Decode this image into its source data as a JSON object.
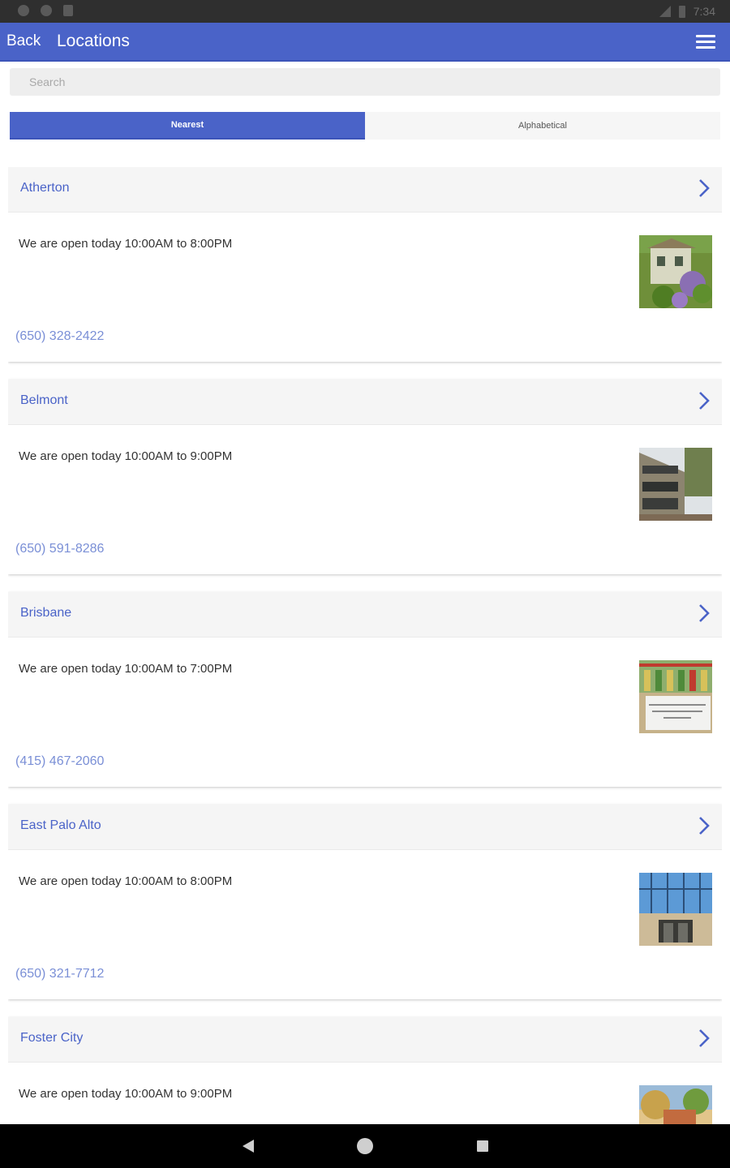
{
  "status_bar": {
    "time": "7:34"
  },
  "app_bar": {
    "back_label": "Back",
    "title": "Locations",
    "menu_icon": "menu-icon"
  },
  "search": {
    "placeholder": "Search",
    "value": ""
  },
  "tabs": [
    {
      "label": "Nearest",
      "active": true
    },
    {
      "label": "Alphabetical",
      "active": false
    }
  ],
  "accent_color": "#4a63c8",
  "locations": [
    {
      "name": "Atherton",
      "hours": "We are open today 10:00AM to 8:00PM",
      "phone": "(650) 328-2422"
    },
    {
      "name": "Belmont",
      "hours": "We are open today 10:00AM to 9:00PM",
      "phone": "(650) 591-8286"
    },
    {
      "name": "Brisbane",
      "hours": "We are open today 10:00AM to 7:00PM",
      "phone": "(415) 467-2060"
    },
    {
      "name": "East Palo Alto",
      "hours": "We are open today 10:00AM to 8:00PM",
      "phone": "(650) 321-7712"
    },
    {
      "name": "Foster City",
      "hours": "We are open today 10:00AM to 9:00PM",
      "phone": ""
    }
  ]
}
